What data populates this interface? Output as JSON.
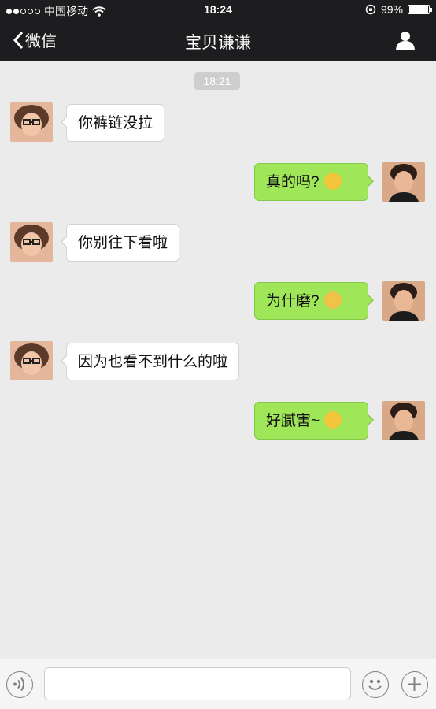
{
  "status_bar": {
    "carrier": "中国移动",
    "time": "18:24",
    "battery": "99%",
    "battery_level": 0.99
  },
  "nav": {
    "back_label": "微信",
    "title": "宝贝谦谦"
  },
  "chat": {
    "timestamp": "18:21",
    "messages": [
      {
        "side": "in",
        "text": "你裤链没拉",
        "emoji": ""
      },
      {
        "side": "out",
        "text": "真的吗?",
        "emoji": "scream-emoji"
      },
      {
        "side": "in",
        "text": "你别往下看啦",
        "emoji": ""
      },
      {
        "side": "out",
        "text": "为什磨?",
        "emoji": "fearful-emoji"
      },
      {
        "side": "in",
        "text": "因为也看不到什么的啦",
        "emoji": ""
      },
      {
        "side": "out",
        "text": "好腻害~",
        "emoji": "tears-of-joy-emoji"
      }
    ]
  },
  "input_bar": {
    "text_value": "",
    "icons": [
      "voice-icon",
      "emoji-icon",
      "plus-icon"
    ]
  },
  "colors": {
    "bar_bg": "#1d1d1f",
    "chat_bg": "#ebebeb",
    "outgoing_bubble": "#9fe658",
    "incoming_bubble": "#ffffff",
    "emoji_yellow": "#f3c53a"
  }
}
